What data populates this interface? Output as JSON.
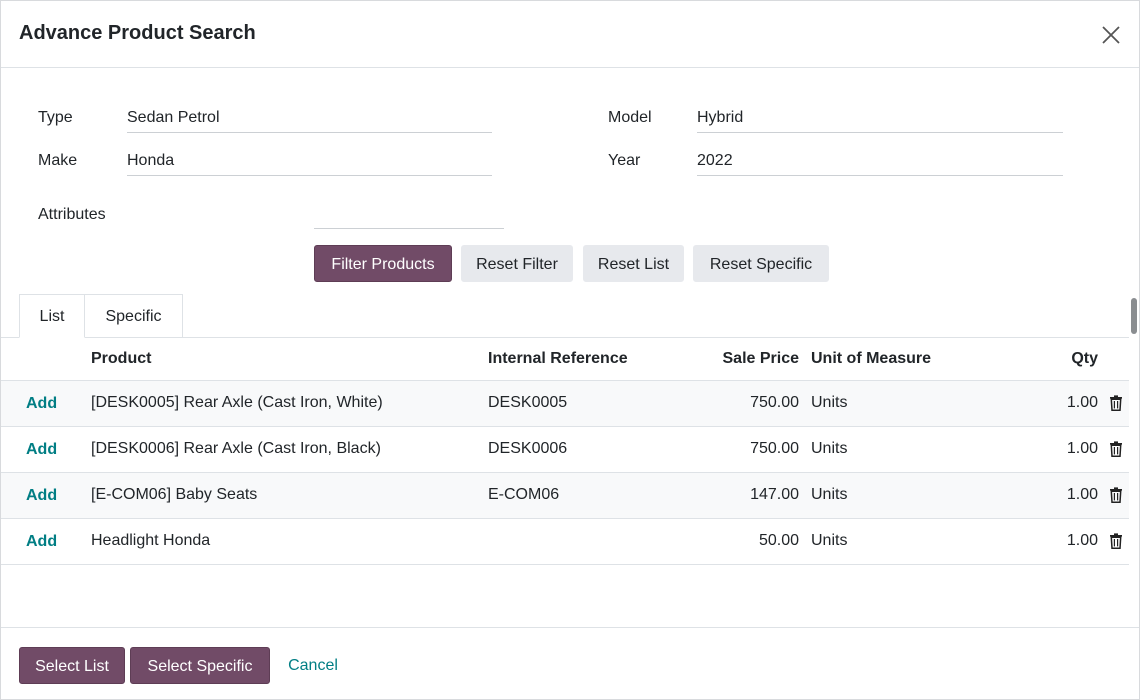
{
  "dialog": {
    "title": "Advance Product Search"
  },
  "form": {
    "type": {
      "label": "Type",
      "value": "Sedan Petrol"
    },
    "model": {
      "label": "Model",
      "value": "Hybrid"
    },
    "make": {
      "label": "Make",
      "value": "Honda"
    },
    "year": {
      "label": "Year",
      "value": "2022"
    },
    "attributes": {
      "label": "Attributes",
      "value": ""
    }
  },
  "actions": {
    "filter": "Filter Products",
    "reset_filter": "Reset Filter",
    "reset_list": "Reset List",
    "reset_specific": "Reset Specific"
  },
  "tabs": [
    {
      "label": "List",
      "active": true
    },
    {
      "label": "Specific",
      "active": false
    }
  ],
  "table": {
    "headers": {
      "product": "Product",
      "internal_reference": "Internal Reference",
      "sale_price": "Sale Price",
      "uom": "Unit of Measure",
      "qty": "Qty"
    },
    "add_label": "Add",
    "rows": [
      {
        "product": "[DESK0005] Rear Axle (Cast Iron, White)",
        "ref": "DESK0005",
        "price": "750.00",
        "uom": "Units",
        "qty": "1.00"
      },
      {
        "product": "[DESK0006] Rear Axle (Cast Iron, Black)",
        "ref": "DESK0006",
        "price": "750.00",
        "uom": "Units",
        "qty": "1.00"
      },
      {
        "product": "[E-COM06] Baby Seats",
        "ref": "E-COM06",
        "price": "147.00",
        "uom": "Units",
        "qty": "1.00"
      },
      {
        "product": "Headlight Honda",
        "ref": "",
        "price": "50.00",
        "uom": "Units",
        "qty": "1.00"
      }
    ]
  },
  "footer": {
    "select_list": "Select List",
    "select_specific": "Select Specific",
    "cancel": "Cancel"
  },
  "colors": {
    "primary": "#714b67",
    "link": "#017e84"
  },
  "icons": {
    "close": "close-icon",
    "trash": "trash-icon"
  }
}
